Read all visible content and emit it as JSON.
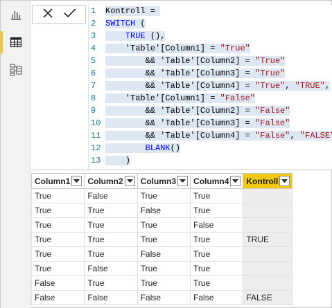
{
  "rail": {
    "items": [
      {
        "name": "report-view-icon",
        "active": false
      },
      {
        "name": "data-view-icon",
        "active": true
      },
      {
        "name": "model-view-icon",
        "active": false
      }
    ]
  },
  "formula_bar": {
    "cancel_icon": "close-icon",
    "commit_icon": "checkmark-icon",
    "lines": [
      {
        "n": "1",
        "segs": [
          {
            "t": "Kontroll = ",
            "c": ""
          }
        ]
      },
      {
        "n": "2",
        "segs": [
          {
            "t": "SWITCH",
            "c": "kw"
          },
          {
            "t": " (",
            "c": ""
          }
        ]
      },
      {
        "n": "3",
        "segs": [
          {
            "t": "    ",
            "c": ""
          },
          {
            "t": "TRUE",
            "c": "kw"
          },
          {
            "t": " (),",
            "c": ""
          }
        ]
      },
      {
        "n": "4",
        "segs": [
          {
            "t": "    'Table'[Column1] = ",
            "c": ""
          },
          {
            "t": "\"True\"",
            "c": "str"
          }
        ]
      },
      {
        "n": "5",
        "segs": [
          {
            "t": "        && 'Table'[Column2] = ",
            "c": ""
          },
          {
            "t": "\"True\"",
            "c": "str"
          }
        ]
      },
      {
        "n": "6",
        "segs": [
          {
            "t": "        && 'Table'[Column3] = ",
            "c": ""
          },
          {
            "t": "\"True\"",
            "c": "str"
          }
        ]
      },
      {
        "n": "7",
        "segs": [
          {
            "t": "        && 'Table'[Column4] = ",
            "c": ""
          },
          {
            "t": "\"True\"",
            "c": "str"
          },
          {
            "t": ", ",
            "c": ""
          },
          {
            "t": "\"TRUE\"",
            "c": "str"
          },
          {
            "t": ",",
            "c": ""
          }
        ]
      },
      {
        "n": "8",
        "segs": [
          {
            "t": "    'Table'[Column1] = ",
            "c": ""
          },
          {
            "t": "\"False\"",
            "c": "str"
          }
        ]
      },
      {
        "n": "9",
        "segs": [
          {
            "t": "        && 'Table'[Column2] = ",
            "c": ""
          },
          {
            "t": "\"False\"",
            "c": "str"
          }
        ]
      },
      {
        "n": "10",
        "segs": [
          {
            "t": "        && 'Table'[Column3] = ",
            "c": ""
          },
          {
            "t": "\"False\"",
            "c": "str"
          }
        ]
      },
      {
        "n": "11",
        "segs": [
          {
            "t": "        && 'Table'[Column4] = ",
            "c": ""
          },
          {
            "t": "\"False\"",
            "c": "str"
          },
          {
            "t": ", ",
            "c": ""
          },
          {
            "t": "\"FALSE\"",
            "c": "str"
          },
          {
            "t": ",",
            "c": ""
          }
        ]
      },
      {
        "n": "12",
        "segs": [
          {
            "t": "        ",
            "c": ""
          },
          {
            "t": "BLANK",
            "c": "kw"
          },
          {
            "t": "()",
            "c": ""
          }
        ]
      },
      {
        "n": "13",
        "segs": [
          {
            "t": "    )",
            "c": ""
          }
        ]
      }
    ]
  },
  "table": {
    "columns": [
      "Column1",
      "Column2",
      "Column3",
      "Column4",
      "Kontroll"
    ],
    "highlighted_column": "Kontroll",
    "rows": [
      [
        "True",
        "False",
        "True",
        "True",
        ""
      ],
      [
        "True",
        "True",
        "False",
        "True",
        ""
      ],
      [
        "True",
        "True",
        "True",
        "False",
        ""
      ],
      [
        "True",
        "True",
        "True",
        "True",
        "TRUE"
      ],
      [
        "True",
        "True",
        "False",
        "True",
        ""
      ],
      [
        "True",
        "False",
        "True",
        "True",
        ""
      ],
      [
        "False",
        "True",
        "True",
        "True",
        ""
      ],
      [
        "False",
        "False",
        "False",
        "False",
        "FALSE"
      ]
    ]
  },
  "colors": {
    "accent": "#f2c811",
    "keyword": "#0000ff",
    "string": "#a31515",
    "line_number": "#237893",
    "selection": "#dde7f3"
  }
}
